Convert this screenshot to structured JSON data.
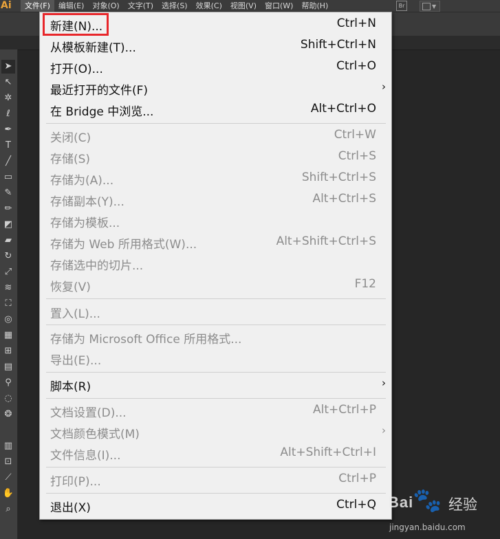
{
  "app": {
    "logo": "Ai"
  },
  "menubar": {
    "items": [
      {
        "label": "文件(F)",
        "active": true
      },
      {
        "label": "编辑(E)"
      },
      {
        "label": "对象(O)"
      },
      {
        "label": "文字(T)"
      },
      {
        "label": "选择(S)"
      },
      {
        "label": "效果(C)"
      },
      {
        "label": "视图(V)"
      },
      {
        "label": "窗口(W)"
      },
      {
        "label": "帮助(H)"
      }
    ],
    "br_badge": "Br"
  },
  "file_menu": {
    "items": [
      {
        "label": "新建(N)...",
        "shortcut": "Ctrl+N",
        "enabled": true
      },
      {
        "label": "从模板新建(T)...",
        "shortcut": "Shift+Ctrl+N",
        "enabled": true
      },
      {
        "label": "打开(O)...",
        "shortcut": "Ctrl+O",
        "enabled": true
      },
      {
        "label": "最近打开的文件(F)",
        "shortcut": "",
        "enabled": true,
        "submenu": true
      },
      {
        "label": "在 Bridge 中浏览...",
        "shortcut": "Alt+Ctrl+O",
        "enabled": true
      },
      {
        "label": "关闭(C)",
        "shortcut": "Ctrl+W",
        "enabled": false
      },
      {
        "label": "存储(S)",
        "shortcut": "Ctrl+S",
        "enabled": false
      },
      {
        "label": "存储为(A)...",
        "shortcut": "Shift+Ctrl+S",
        "enabled": false
      },
      {
        "label": "存储副本(Y)...",
        "shortcut": "Alt+Ctrl+S",
        "enabled": false
      },
      {
        "label": "存储为模板...",
        "shortcut": "",
        "enabled": false
      },
      {
        "label": "存储为 Web 所用格式(W)...",
        "shortcut": "Alt+Shift+Ctrl+S",
        "enabled": false
      },
      {
        "label": "存储选中的切片...",
        "shortcut": "",
        "enabled": false
      },
      {
        "label": "恢复(V)",
        "shortcut": "F12",
        "enabled": false
      },
      {
        "label": "置入(L)...",
        "shortcut": "",
        "enabled": false
      },
      {
        "label": "存储为 Microsoft Office 所用格式...",
        "shortcut": "",
        "enabled": false
      },
      {
        "label": "导出(E)...",
        "shortcut": "",
        "enabled": false
      },
      {
        "label": "脚本(R)",
        "shortcut": "",
        "enabled": true,
        "submenu": true
      },
      {
        "label": "文档设置(D)...",
        "shortcut": "Alt+Ctrl+P",
        "enabled": false
      },
      {
        "label": "文档颜色模式(M)",
        "shortcut": "",
        "enabled": false,
        "submenu": true
      },
      {
        "label": "文件信息(I)...",
        "shortcut": "Alt+Shift+Ctrl+I",
        "enabled": false
      },
      {
        "label": "打印(P)...",
        "shortcut": "Ctrl+P",
        "enabled": false
      },
      {
        "label": "退出(X)",
        "shortcut": "Ctrl+Q",
        "enabled": true
      }
    ],
    "submenu_arrow": "›",
    "highlight_color": "#e8262a"
  },
  "watermark": {
    "brand": "Bai",
    "brand_cn": "经验",
    "url": "jingyan.baidu.com"
  }
}
